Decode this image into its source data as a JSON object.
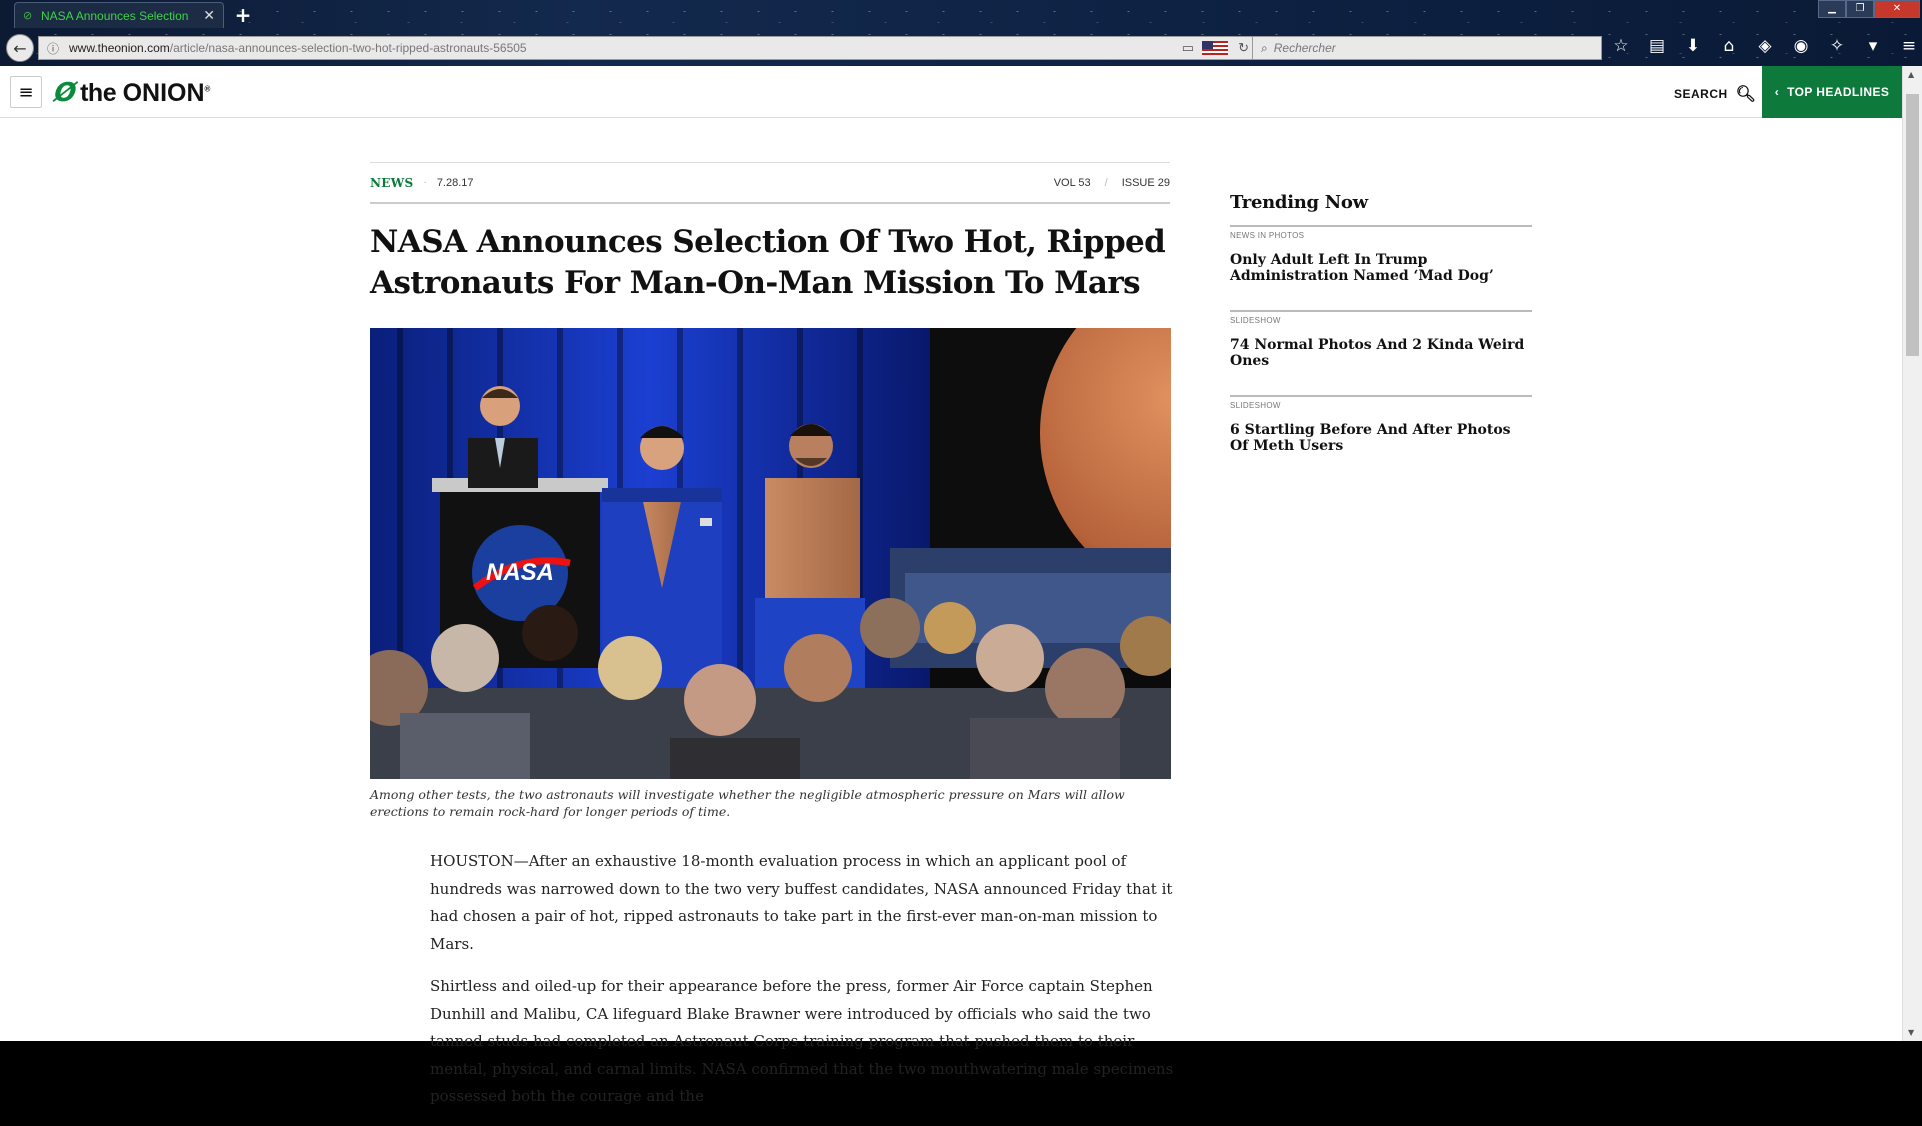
{
  "browser": {
    "tab_title": "NASA Announces Selection",
    "url_domain": "www.theonion.com",
    "url_path": "/article/nasa-announces-selection-two-hot-ripped-astronauts-56505",
    "search_placeholder": "Rechercher"
  },
  "site": {
    "logo_the": "the",
    "logo_onion": "ONION",
    "search_label": "SEARCH",
    "top_headlines_label": "TOP HEADLINES",
    "accent_color": "#0d7a3b"
  },
  "article": {
    "section": "NEWS",
    "date": "7.28.17",
    "volume": "VOL 53",
    "issue": "ISSUE 29",
    "headline": "NASA Announces Selection Of Two Hot, Ripped Astronauts For Man-On-Man Mission To Mars",
    "podium_logo": "NASA",
    "caption": "Among other tests, the two astronauts will investigate whether the negligible atmospheric pressure on Mars will allow erections to remain rock-hard for longer periods of time.",
    "paragraphs": [
      "HOUSTON—After an exhaustive 18-month evaluation process in which an applicant pool of hundreds was narrowed down to the two very buffest candidates, NASA announced Friday that it had chosen a pair of hot, ripped astronauts to take part in the first-ever man-on-man mission to Mars.",
      "Shirtless and oiled-up for their appearance before the press, former Air Force captain Stephen Dunhill and Malibu, CA lifeguard Blake Brawner were introduced by officials who said the two tanned studs had completed an Astronaut Corps training program that pushed them to their mental, physical, and carnal limits. NASA confirmed that the two mouthwatering male specimens possessed both the courage and the"
    ]
  },
  "trending": {
    "heading": "Trending Now",
    "items": [
      {
        "kicker": "NEWS IN PHOTOS",
        "title": "Only Adult Left In Trump Administration Named ‘Mad Dog’"
      },
      {
        "kicker": "SLIDESHOW",
        "title": "74 Normal Photos And 2 Kinda Weird Ones"
      },
      {
        "kicker": "SLIDESHOW",
        "title": "6 Startling Before And After Photos Of Meth Users"
      }
    ]
  }
}
